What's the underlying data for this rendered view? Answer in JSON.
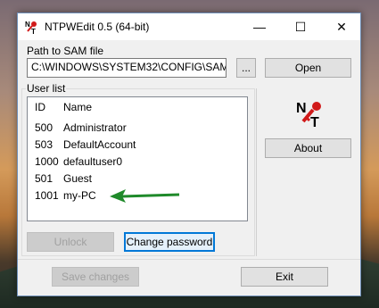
{
  "window": {
    "title": "NTPWEdit 0.5 (64-bit)",
    "controls": {
      "minimize": "—",
      "maximize": "☐",
      "close": "✕"
    }
  },
  "sam": {
    "label": "Path to SAM file",
    "path_value": "C:\\WINDOWS\\SYSTEM32\\CONFIG\\SAM",
    "browse_label": "...",
    "open_label": "Open"
  },
  "users": {
    "label": "User list",
    "columns": [
      "ID",
      "Name"
    ],
    "rows": [
      {
        "id": "500",
        "name": "Administrator"
      },
      {
        "id": "503",
        "name": "DefaultAccount"
      },
      {
        "id": "1000",
        "name": "defaultuser0"
      },
      {
        "id": "501",
        "name": "Guest"
      },
      {
        "id": "1001",
        "name": "my-PC"
      }
    ],
    "unlock_label": "Unlock",
    "change_password_label": "Change password"
  },
  "side": {
    "logo_letters": "NT",
    "about_label": "About"
  },
  "footer": {
    "save_label": "Save changes",
    "exit_label": "Exit"
  },
  "colors": {
    "arrow": "#1f8a2a",
    "logo_key": "#d11a1a",
    "focus_border": "#0078d7"
  },
  "icons": {
    "title": "ntpwedit-key-icon",
    "logo": "ntpwedit-logo-icon",
    "annotation": "green-arrow-icon"
  }
}
